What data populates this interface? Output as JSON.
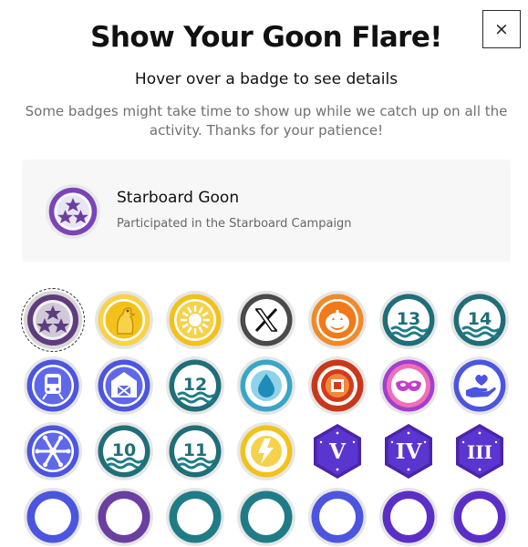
{
  "modal": {
    "close_label": "×",
    "title": "Show Your Goon Flare!",
    "subtitle": "Hover over a badge to see details",
    "note": "Some badges might take time to show up while we catch up on all the activity. Thanks for your patience!"
  },
  "detail": {
    "name": "Starboard Goon",
    "description": "Participated in the Starboard Campaign",
    "icon": "stars-badge-icon"
  },
  "badges": [
    {
      "icon": "stars-badge-icon",
      "color": "#6b3fa0",
      "selected": true
    },
    {
      "icon": "goose-badge-icon",
      "color": "#f2c21b"
    },
    {
      "icon": "sun-badge-icon",
      "color": "#e5b514"
    },
    {
      "icon": "x-logo-badge-icon",
      "color": "#555555"
    },
    {
      "icon": "pumpkin-badge-icon",
      "color": "#f07a1a"
    },
    {
      "icon": "thirteen-badge-icon",
      "label": "13",
      "color": "#1f7c86"
    },
    {
      "icon": "fourteen-badge-icon",
      "label": "14",
      "color": "#1f7c86"
    },
    {
      "icon": "train-badge-icon",
      "color": "#4c55e0"
    },
    {
      "icon": "barn-badge-icon",
      "color": "#4c55e0"
    },
    {
      "icon": "twelve-badge-icon",
      "label": "12",
      "color": "#1f7c86"
    },
    {
      "icon": "water-drop-badge-icon",
      "color": "#3aa0c0"
    },
    {
      "icon": "target-badge-icon",
      "color": "#d63a1a"
    },
    {
      "icon": "mask-badge-icon",
      "color": "#c23fc9"
    },
    {
      "icon": "heart-hand-badge-icon",
      "color": "#4c55e0"
    },
    {
      "icon": "snowflake-badge-icon",
      "color": "#4c55e0"
    },
    {
      "icon": "ten-badge-icon",
      "label": "10",
      "color": "#1f7c86"
    },
    {
      "icon": "eleven-badge-icon",
      "label": "11",
      "color": "#1f7c86"
    },
    {
      "icon": "lightning-badge-icon",
      "color": "#e5b514"
    },
    {
      "icon": "roman-v-badge-icon",
      "label": "V",
      "color": "#5b2fc7"
    },
    {
      "icon": "roman-iv-badge-icon",
      "label": "IV",
      "color": "#5b2fc7"
    },
    {
      "icon": "roman-iii-badge-icon",
      "label": "III",
      "color": "#5b2fc7"
    },
    {
      "icon": "partial-badge-icon",
      "color": "#4c55e0"
    },
    {
      "icon": "partial-badge-icon",
      "color": "#6b3fa0"
    },
    {
      "icon": "partial-badge-icon",
      "color": "#1f7c86"
    },
    {
      "icon": "partial-badge-icon",
      "color": "#1f7c86"
    },
    {
      "icon": "partial-badge-icon",
      "color": "#4c55e0"
    },
    {
      "icon": "partial-badge-icon",
      "color": "#5b2fc7"
    },
    {
      "icon": "partial-badge-icon",
      "color": "#5b2fc7"
    }
  ]
}
